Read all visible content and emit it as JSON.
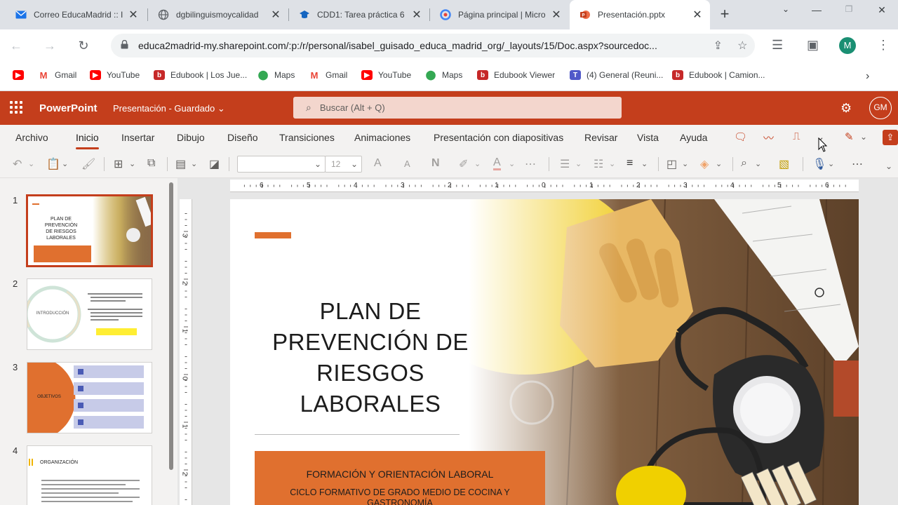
{
  "browser": {
    "tabs": [
      {
        "title": "Correo EducaMadrid :: I",
        "icon": "mail-icon",
        "color": "#1a73e8"
      },
      {
        "title": "dgbilinguismoycalidad",
        "icon": "globe-icon",
        "color": "#5f6368"
      },
      {
        "title": "CDD1: Tarea práctica 6",
        "icon": "moodle-icon",
        "color": "#1565c0"
      },
      {
        "title": "Página principal | Micro",
        "icon": "google-icon",
        "color": "#4285f4"
      },
      {
        "title": "Presentación.pptx",
        "icon": "powerpoint-icon",
        "color": "#c43e1c"
      }
    ],
    "url": "educa2madrid-my.sharepoint.com/:p:/r/personal/isabel_guisado_educa_madrid_org/_layouts/15/Doc.aspx?sourcedoc...",
    "profile_initial": "M",
    "bookmarks": [
      {
        "label": "",
        "icon": "youtube-icon"
      },
      {
        "label": "Gmail",
        "icon": "gmail-icon"
      },
      {
        "label": "YouTube",
        "icon": "youtube-icon"
      },
      {
        "label": "Edubook | Los Jue...",
        "icon": "edubook-icon"
      },
      {
        "label": "Maps",
        "icon": "maps-icon"
      },
      {
        "label": "Gmail",
        "icon": "gmail-icon"
      },
      {
        "label": "YouTube",
        "icon": "youtube-icon"
      },
      {
        "label": "Maps",
        "icon": "maps-icon"
      },
      {
        "label": "Edubook Viewer",
        "icon": "edubook-icon"
      },
      {
        "label": "(4) General (Reuni...",
        "icon": "teams-icon"
      },
      {
        "label": "Edubook | Camion...",
        "icon": "edubook-icon"
      }
    ]
  },
  "app": {
    "name": "PowerPoint",
    "doc_title": "Presentación - Guardado",
    "search_placeholder": "Buscar (Alt + Q)",
    "user_initials": "GM",
    "brand_color": "#c43e1c",
    "ribbon_tabs": [
      "Archivo",
      "Inicio",
      "Insertar",
      "Dibujo",
      "Diseño",
      "Transiciones",
      "Animaciones",
      "Presentación con diapositivas",
      "Revisar",
      "Vista",
      "Ayuda"
    ],
    "selected_tab": "Inicio",
    "font_size": "12"
  },
  "ruler": {
    "h_labels": [
      "6",
      "5",
      "4",
      "3",
      "2",
      "1",
      "0",
      "1",
      "2",
      "3",
      "4",
      "5",
      "6"
    ],
    "v_labels": [
      "3",
      "2",
      "1",
      "0",
      "1",
      "2"
    ]
  },
  "thumbnails": [
    {
      "number": "1",
      "title": "PLAN DE PREVENCIÓN DE RIESGOS LABORALES",
      "selected": true
    },
    {
      "number": "2",
      "title": "INTRODUCCIÓN",
      "selected": false
    },
    {
      "number": "3",
      "title": "OBJETIVOS",
      "selected": false
    },
    {
      "number": "4",
      "title": "ORGANIZACIÓN",
      "selected": false
    }
  ],
  "slide": {
    "title_lines": [
      "PLAN DE",
      "PREVENCIÓN DE",
      "RIESGOS",
      "LABORALES"
    ],
    "subtitle1": "FORMACIÓN Y ORIENTACIÓN LABORAL",
    "subtitle2": "CICLO FORMATIVO DE GRADO MEDIO DE COCINA Y GASTRONOMÍA",
    "accent_color": "#e0702f"
  }
}
